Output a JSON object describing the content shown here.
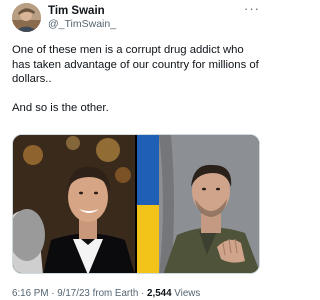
{
  "author": {
    "display_name": "Tim Swain",
    "handle": "@_TimSwain_"
  },
  "more_icon": "more-horizontal-icon",
  "tweet": {
    "paragraphs": [
      "One of these men is a corrupt drug addict who has taken advantage of our country for millions of dollars..",
      "And so is the other."
    ]
  },
  "media": {
    "count": 2
  },
  "meta": {
    "timestamp": "6:16 PM · 9/17/23 from Earth · ",
    "views_count": "2,544",
    "views_label": " Views"
  }
}
